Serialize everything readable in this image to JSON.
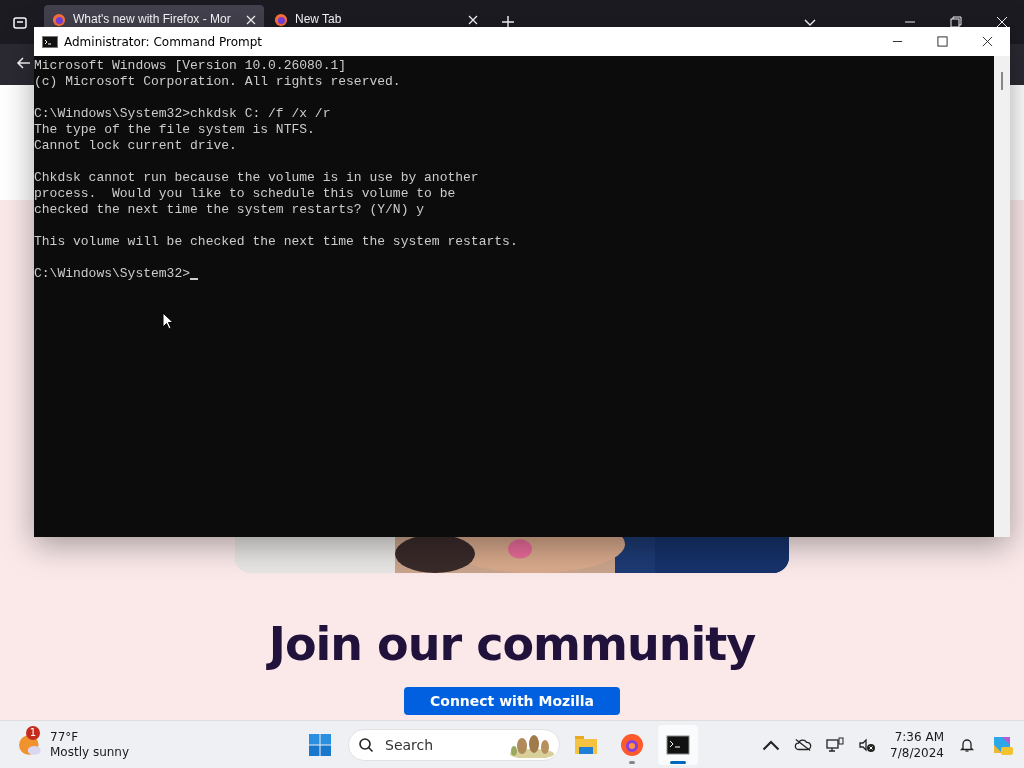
{
  "browser": {
    "tabs": [
      {
        "label": "What's new with Firefox - Mor",
        "selected": true
      },
      {
        "label": "New Tab",
        "selected": false
      }
    ],
    "page": {
      "heading": "Join our community",
      "button": "Connect with Mozilla"
    }
  },
  "console_window": {
    "title": "Administrator: Command Prompt",
    "blocks": [
      [
        "Microsoft Windows [Version 10.0.26080.1]",
        "(c) Microsoft Corporation. All rights reserved."
      ],
      [
        "C:\\Windows\\System32>chkdsk C: /f /x /r",
        "The type of the file system is NTFS.",
        "Cannot lock current drive."
      ],
      [
        "Chkdsk cannot run because the volume is in use by another",
        "process.  Would you like to schedule this volume to be",
        "checked the next time the system restarts? (Y/N) y"
      ],
      [
        "This volume will be checked the next time the system restarts."
      ]
    ],
    "prompt": "C:\\Windows\\System32>"
  },
  "taskbar": {
    "weather": {
      "badge": "1",
      "temperature": "77°F",
      "condition": "Mostly sunny"
    },
    "search": {
      "placeholder": "Search"
    },
    "apps": [
      {
        "kind": "folder",
        "running": false,
        "selected": false
      },
      {
        "kind": "firefox",
        "running": true,
        "selected": false
      },
      {
        "kind": "terminal",
        "running": true,
        "selected": true
      }
    ],
    "time": "7:36 AM",
    "date": "7/8/2024"
  }
}
